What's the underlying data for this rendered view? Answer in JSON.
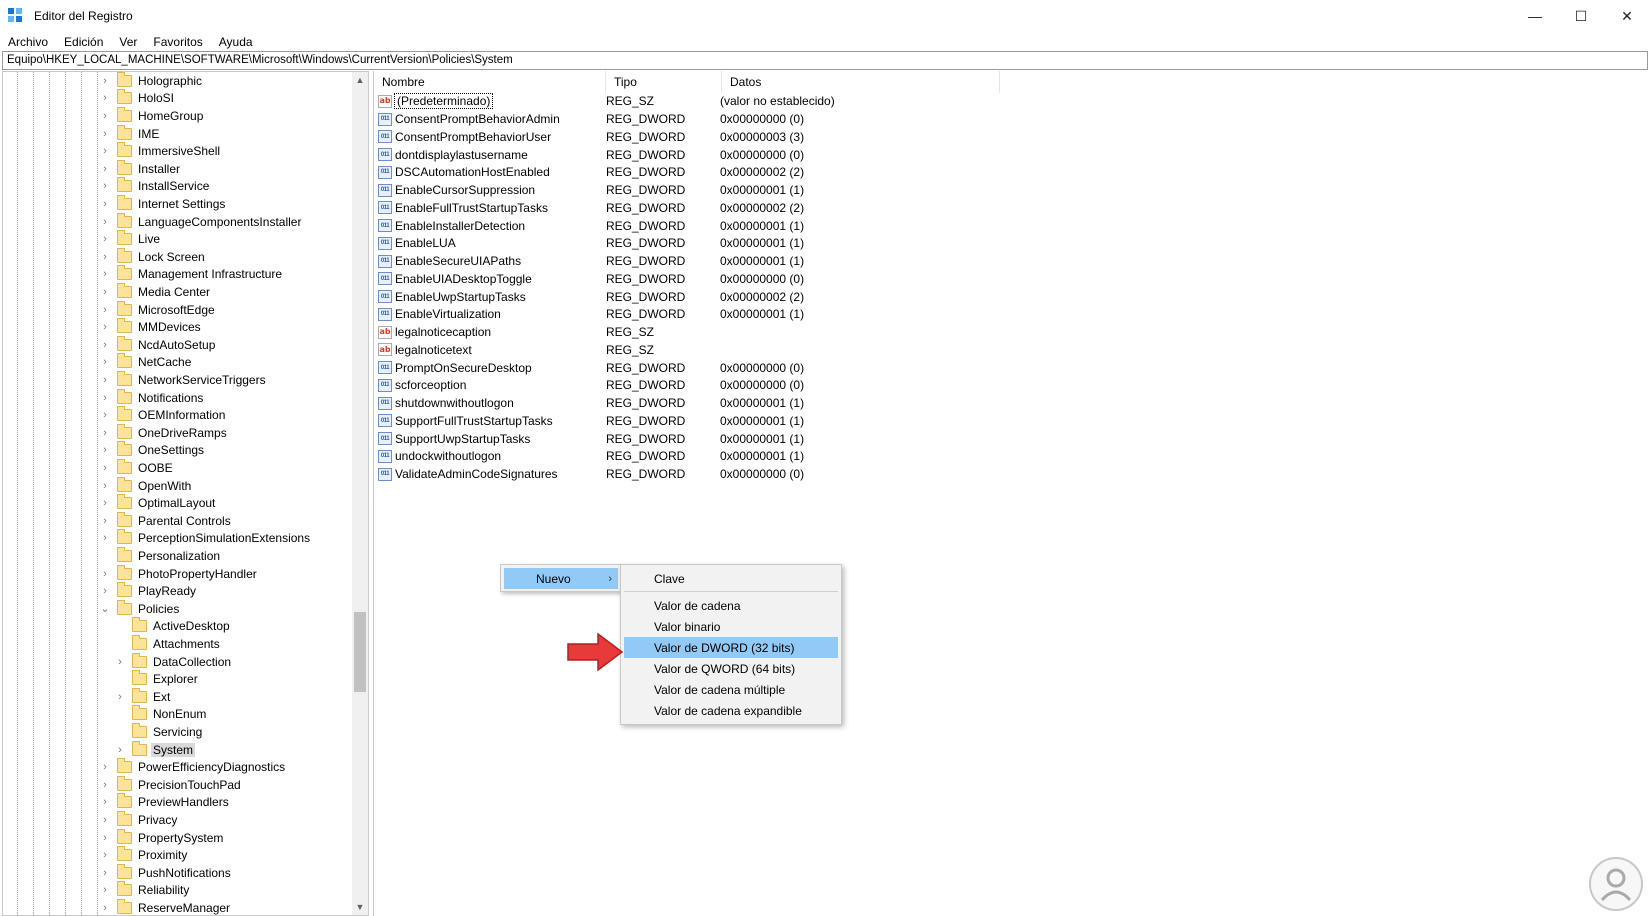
{
  "window": {
    "title": "Editor del Registro",
    "controls": {
      "minimize": "—",
      "maximize": "☐",
      "close": "✕"
    }
  },
  "menu": [
    "Archivo",
    "Edición",
    "Ver",
    "Favoritos",
    "Ayuda"
  ],
  "address": "Equipo\\HKEY_LOCAL_MACHINE\\SOFTWARE\\Microsoft\\Windows\\CurrentVersion\\Policies\\System",
  "tree": {
    "items": [
      {
        "label": "Holographic",
        "level": 0,
        "expander": "collapsed"
      },
      {
        "label": "HoloSI",
        "level": 0,
        "expander": "collapsed"
      },
      {
        "label": "HomeGroup",
        "level": 0,
        "expander": "collapsed"
      },
      {
        "label": "IME",
        "level": 0,
        "expander": "collapsed"
      },
      {
        "label": "ImmersiveShell",
        "level": 0,
        "expander": "collapsed"
      },
      {
        "label": "Installer",
        "level": 0,
        "expander": "collapsed"
      },
      {
        "label": "InstallService",
        "level": 0,
        "expander": "collapsed"
      },
      {
        "label": "Internet Settings",
        "level": 0,
        "expander": "collapsed"
      },
      {
        "label": "LanguageComponentsInstaller",
        "level": 0,
        "expander": "collapsed"
      },
      {
        "label": "Live",
        "level": 0,
        "expander": "collapsed"
      },
      {
        "label": "Lock Screen",
        "level": 0,
        "expander": "collapsed"
      },
      {
        "label": "Management Infrastructure",
        "level": 0,
        "expander": "collapsed"
      },
      {
        "label": "Media Center",
        "level": 0,
        "expander": "collapsed"
      },
      {
        "label": "MicrosoftEdge",
        "level": 0,
        "expander": "collapsed"
      },
      {
        "label": "MMDevices",
        "level": 0,
        "expander": "collapsed"
      },
      {
        "label": "NcdAutoSetup",
        "level": 0,
        "expander": "collapsed"
      },
      {
        "label": "NetCache",
        "level": 0,
        "expander": "collapsed"
      },
      {
        "label": "NetworkServiceTriggers",
        "level": 0,
        "expander": "collapsed"
      },
      {
        "label": "Notifications",
        "level": 0,
        "expander": "collapsed"
      },
      {
        "label": "OEMInformation",
        "level": 0,
        "expander": "collapsed"
      },
      {
        "label": "OneDriveRamps",
        "level": 0,
        "expander": "collapsed"
      },
      {
        "label": "OneSettings",
        "level": 0,
        "expander": "collapsed"
      },
      {
        "label": "OOBE",
        "level": 0,
        "expander": "collapsed"
      },
      {
        "label": "OpenWith",
        "level": 0,
        "expander": "collapsed"
      },
      {
        "label": "OptimalLayout",
        "level": 0,
        "expander": "collapsed"
      },
      {
        "label": "Parental Controls",
        "level": 0,
        "expander": "collapsed"
      },
      {
        "label": "PerceptionSimulationExtensions",
        "level": 0,
        "expander": "collapsed"
      },
      {
        "label": "Personalization",
        "level": 0,
        "expander": "none"
      },
      {
        "label": "PhotoPropertyHandler",
        "level": 0,
        "expander": "collapsed"
      },
      {
        "label": "PlayReady",
        "level": 0,
        "expander": "collapsed"
      },
      {
        "label": "Policies",
        "level": 0,
        "expander": "expanded"
      },
      {
        "label": "ActiveDesktop",
        "level": 1,
        "expander": "none"
      },
      {
        "label": "Attachments",
        "level": 1,
        "expander": "none"
      },
      {
        "label": "DataCollection",
        "level": 1,
        "expander": "collapsed"
      },
      {
        "label": "Explorer",
        "level": 1,
        "expander": "none"
      },
      {
        "label": "Ext",
        "level": 1,
        "expander": "collapsed"
      },
      {
        "label": "NonEnum",
        "level": 1,
        "expander": "none"
      },
      {
        "label": "Servicing",
        "level": 1,
        "expander": "none"
      },
      {
        "label": "System",
        "level": 1,
        "expander": "collapsed",
        "selected": true
      },
      {
        "label": "PowerEfficiencyDiagnostics",
        "level": 0,
        "expander": "collapsed"
      },
      {
        "label": "PrecisionTouchPad",
        "level": 0,
        "expander": "collapsed"
      },
      {
        "label": "PreviewHandlers",
        "level": 0,
        "expander": "collapsed"
      },
      {
        "label": "Privacy",
        "level": 0,
        "expander": "collapsed"
      },
      {
        "label": "PropertySystem",
        "level": 0,
        "expander": "collapsed"
      },
      {
        "label": "Proximity",
        "level": 0,
        "expander": "collapsed"
      },
      {
        "label": "PushNotifications",
        "level": 0,
        "expander": "collapsed"
      },
      {
        "label": "Reliability",
        "level": 0,
        "expander": "collapsed"
      },
      {
        "label": "ReserveManager",
        "level": 0,
        "expander": "collapsed"
      }
    ]
  },
  "list": {
    "columns": [
      "Nombre",
      "Tipo",
      "Datos"
    ],
    "rows": [
      {
        "icon": "string-value-icon",
        "name": "(Predeterminado)",
        "type": "REG_SZ",
        "data": "(valor no establecido)",
        "focused": true
      },
      {
        "icon": "dword-value-icon",
        "name": "ConsentPromptBehaviorAdmin",
        "type": "REG_DWORD",
        "data": "0x00000000 (0)"
      },
      {
        "icon": "dword-value-icon",
        "name": "ConsentPromptBehaviorUser",
        "type": "REG_DWORD",
        "data": "0x00000003 (3)"
      },
      {
        "icon": "dword-value-icon",
        "name": "dontdisplaylastusername",
        "type": "REG_DWORD",
        "data": "0x00000000 (0)"
      },
      {
        "icon": "dword-value-icon",
        "name": "DSCAutomationHostEnabled",
        "type": "REG_DWORD",
        "data": "0x00000002 (2)"
      },
      {
        "icon": "dword-value-icon",
        "name": "EnableCursorSuppression",
        "type": "REG_DWORD",
        "data": "0x00000001 (1)"
      },
      {
        "icon": "dword-value-icon",
        "name": "EnableFullTrustStartupTasks",
        "type": "REG_DWORD",
        "data": "0x00000002 (2)"
      },
      {
        "icon": "dword-value-icon",
        "name": "EnableInstallerDetection",
        "type": "REG_DWORD",
        "data": "0x00000001 (1)"
      },
      {
        "icon": "dword-value-icon",
        "name": "EnableLUA",
        "type": "REG_DWORD",
        "data": "0x00000001 (1)"
      },
      {
        "icon": "dword-value-icon",
        "name": "EnableSecureUIAPaths",
        "type": "REG_DWORD",
        "data": "0x00000001 (1)"
      },
      {
        "icon": "dword-value-icon",
        "name": "EnableUIADesktopToggle",
        "type": "REG_DWORD",
        "data": "0x00000000 (0)"
      },
      {
        "icon": "dword-value-icon",
        "name": "EnableUwpStartupTasks",
        "type": "REG_DWORD",
        "data": "0x00000002 (2)"
      },
      {
        "icon": "dword-value-icon",
        "name": "EnableVirtualization",
        "type": "REG_DWORD",
        "data": "0x00000001 (1)"
      },
      {
        "icon": "string-value-icon",
        "name": "legalnoticecaption",
        "type": "REG_SZ",
        "data": ""
      },
      {
        "icon": "string-value-icon",
        "name": "legalnoticetext",
        "type": "REG_SZ",
        "data": ""
      },
      {
        "icon": "dword-value-icon",
        "name": "PromptOnSecureDesktop",
        "type": "REG_DWORD",
        "data": "0x00000000 (0)"
      },
      {
        "icon": "dword-value-icon",
        "name": "scforceoption",
        "type": "REG_DWORD",
        "data": "0x00000000 (0)"
      },
      {
        "icon": "dword-value-icon",
        "name": "shutdownwithoutlogon",
        "type": "REG_DWORD",
        "data": "0x00000001 (1)"
      },
      {
        "icon": "dword-value-icon",
        "name": "SupportFullTrustStartupTasks",
        "type": "REG_DWORD",
        "data": "0x00000001 (1)"
      },
      {
        "icon": "dword-value-icon",
        "name": "SupportUwpStartupTasks",
        "type": "REG_DWORD",
        "data": "0x00000001 (1)"
      },
      {
        "icon": "dword-value-icon",
        "name": "undockwithoutlogon",
        "type": "REG_DWORD",
        "data": "0x00000001 (1)"
      },
      {
        "icon": "dword-value-icon",
        "name": "ValidateAdminCodeSignatures",
        "type": "REG_DWORD",
        "data": "0x00000000 (0)"
      }
    ]
  },
  "context_menu": {
    "nuevo_label": "Nuevo",
    "submenu_arrow": "›",
    "submenu": [
      {
        "label": "Clave"
      },
      {
        "label": "Valor de cadena"
      },
      {
        "label": "Valor binario"
      },
      {
        "label": "Valor de DWORD (32 bits)",
        "highlighted": true
      },
      {
        "label": "Valor de QWORD (64 bits)"
      },
      {
        "label": "Valor de cadena múltiple"
      },
      {
        "label": "Valor de cadena expandible"
      }
    ]
  },
  "icons": {
    "string_value_glyph": "ab",
    "dword_value_glyph": "011",
    "scroll_up": "▲",
    "scroll_down": "▼",
    "chevron_collapsed": "›",
    "chevron_expanded": "⌄"
  },
  "colors": {
    "highlight": "#91c9f7",
    "selection_gray": "#d9d9d9",
    "pointer_arrow": "#e83a3a"
  }
}
